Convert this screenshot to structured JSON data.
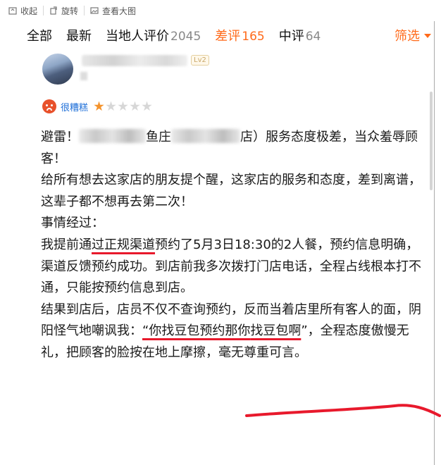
{
  "toolbar": {
    "collapse_label": "收起",
    "rotate_label": "旋转",
    "view_large_label": "查看大图"
  },
  "tabs": {
    "all": "全部",
    "latest": "最新",
    "local": "当地人评价",
    "local_count": "2045",
    "bad": "差评",
    "bad_count": "165",
    "mid": "中评",
    "mid_count": "64",
    "filter": "筛选"
  },
  "reviewer": {
    "level": "Lv2",
    "rating_label": "很糟糕",
    "stars_on": 1,
    "stars_total": 5
  },
  "review": {
    "line1_a": "避雷！",
    "line1_b": "鱼庄",
    "line1_c": "店）服务态度极差，当众羞辱顾客！",
    "para2": "给所有想去这家店的朋友提个醒，这家店的服务和态度，差到离谱，这辈子都不想再去第二次！",
    "para3": "事情经过：",
    "para4_a": "我提前通",
    "para4_hl": "过正规渠道",
    "para4_b": "预约了5月3日18:30的2人餐，预约信息明确，渠道反馈预约成功。到店前我多次拨打门店电话，全程占线根本打不通，只能按预约信息到店。",
    "para5_a": "结果到店后，店员不仅不查询预约，反而当着店里所有客人的面，阴阳怪气地嘲讽我：",
    "para5_hl1": "“你找豆包预约那你",
    "para5_hl2": "找豆包啊",
    "para5_b": "”，全程态度傲慢无礼，把顾客的脸按在地上摩擦，毫无尊重可言。"
  },
  "colors": {
    "accent": "#ff6a1a",
    "underline": "#e8192c",
    "link": "#1f6fd8",
    "star": "#f4932c"
  }
}
